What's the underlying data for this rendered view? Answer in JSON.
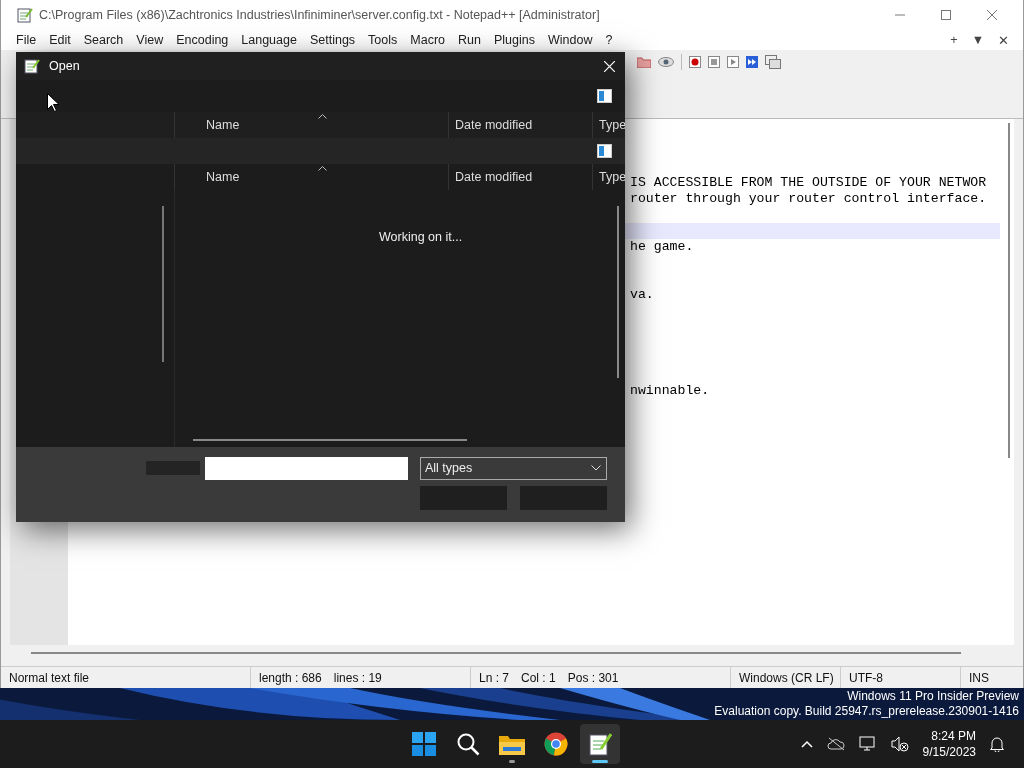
{
  "window": {
    "title": "C:\\Program Files (x86)\\Zachtronics Industries\\Infiniminer\\server.config.txt - Notepad++ [Administrator]"
  },
  "menu": [
    "File",
    "Edit",
    "Search",
    "View",
    "Encoding",
    "Language",
    "Settings",
    "Tools",
    "Macro",
    "Run",
    "Plugins",
    "Window",
    "?"
  ],
  "menu_right": [
    "+",
    "▼",
    "✕"
  ],
  "editor": {
    "lines": [
      {
        "current": false
      },
      {
        "current": false
      },
      {
        "text": "IS ACCESSIBLE FROM THE OUTSIDE OF YOUR NETWOR",
        "current": false
      },
      {
        "text": "router through your router control interface.",
        "current": false
      },
      {
        "current": false
      },
      {
        "current": true
      },
      {
        "text": "he game.",
        "current": false
      },
      {
        "current": false
      },
      {
        "current": false
      },
      {
        "text": "va.",
        "current": false
      },
      {
        "current": false
      },
      {
        "current": false
      },
      {
        "current": false
      },
      {
        "current": false
      },
      {
        "current": false
      },
      {
        "text": "nwinnable.",
        "current": false
      }
    ]
  },
  "dialog": {
    "title": "Open",
    "headers": [
      [
        "Name",
        "Date modified",
        "Type"
      ],
      [
        "Name",
        "Date modified",
        "Type"
      ]
    ],
    "message": "Working on it...",
    "file_type": "All types"
  },
  "status_bar": [
    [
      "Normal text file"
    ],
    [
      "length : 686",
      "lines : 19"
    ],
    [
      "Ln : 7",
      "Col : 1",
      "Pos : 301"
    ],
    [
      "Windows (CR LF)"
    ],
    [
      "UTF-8"
    ],
    [
      "INS"
    ]
  ],
  "watermark": [
    "Windows 11 Pro Insider Preview",
    "Evaluation copy. Build 25947.rs_prerelease.230901-1416"
  ],
  "taskbar": {
    "apps": [
      {
        "kind": "start",
        "selected": false
      },
      {
        "kind": "search",
        "selected": false
      },
      {
        "kind": "explorer",
        "selected": false
      },
      {
        "kind": "chrome",
        "selected": false
      },
      {
        "kind": "notepad",
        "selected": true
      }
    ],
    "time": "8:24 PM",
    "date": "9/15/2023"
  }
}
